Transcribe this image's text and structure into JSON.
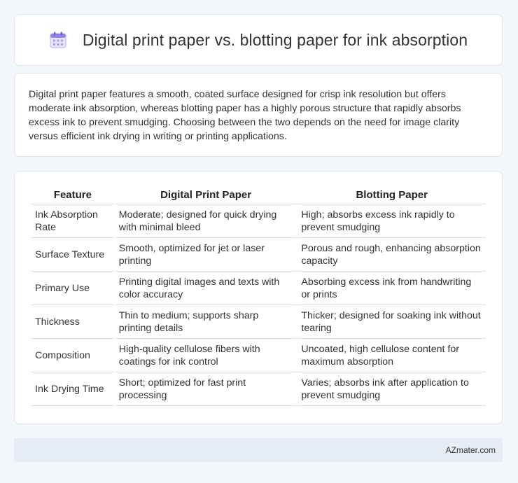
{
  "header": {
    "icon": "calendar-icon",
    "title": "Digital print paper vs. blotting paper for ink absorption"
  },
  "intro": {
    "text": "Digital print paper features a smooth, coated surface designed for crisp ink resolution but offers moderate ink absorption, whereas blotting paper has a highly porous structure that rapidly absorbs excess ink to prevent smudging. Choosing between the two depends on the need for image clarity versus efficient ink drying in writing or printing applications."
  },
  "table": {
    "headers": [
      "Feature",
      "Digital Print Paper",
      "Blotting Paper"
    ],
    "rows": [
      [
        "Ink Absorption Rate",
        "Moderate; designed for quick drying with minimal bleed",
        "High; absorbs excess ink rapidly to prevent smudging"
      ],
      [
        "Surface Texture",
        "Smooth, optimized for jet or laser printing",
        "Porous and rough, enhancing absorption capacity"
      ],
      [
        "Primary Use",
        "Printing digital images and texts with color accuracy",
        "Absorbing excess ink from handwriting or prints"
      ],
      [
        "Thickness",
        "Thin to medium; supports sharp printing details",
        "Thicker; designed for soaking ink without tearing"
      ],
      [
        "Composition",
        "High-quality cellulose fibers with coatings for ink control",
        "Uncoated, high cellulose content for maximum absorption"
      ],
      [
        "Ink Drying Time",
        "Short; optimized for fast print processing",
        "Varies; absorbs ink after application to prevent smudging"
      ]
    ]
  },
  "footer": {
    "brand": "AZmater.com"
  },
  "colors": {
    "background": "#f3f6fb",
    "card": "#ffffff",
    "footer": "#e6ecf6",
    "icon_accent": "#7b6fd6"
  }
}
